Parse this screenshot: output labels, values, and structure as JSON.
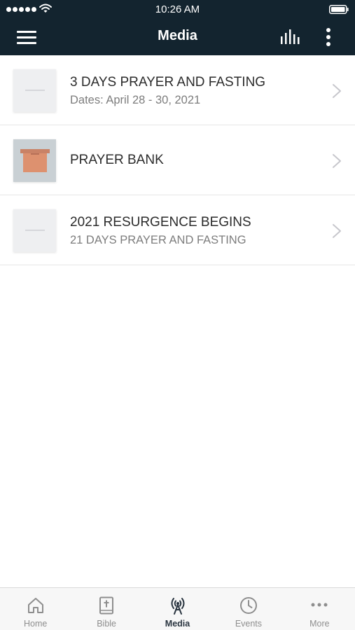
{
  "status_bar": {
    "time": "10:26 AM"
  },
  "header": {
    "title": "Media"
  },
  "media_list": [
    {
      "title": "3 DAYS PRAYER AND FASTING",
      "subtitle": "Dates: April 28 - 30, 2021",
      "thumbnail": "placeholder"
    },
    {
      "title": "PRAYER BANK",
      "subtitle": "",
      "thumbnail": "photo-copper-box"
    },
    {
      "title": "2021 RESURGENCE BEGINS",
      "subtitle": "21 DAYS PRAYER AND FASTING",
      "thumbnail": "placeholder"
    }
  ],
  "tab_bar": {
    "active": "Media",
    "tabs": [
      {
        "label": "Home",
        "icon": "home-icon"
      },
      {
        "label": "Bible",
        "icon": "bible-icon"
      },
      {
        "label": "Media",
        "icon": "broadcast-icon"
      },
      {
        "label": "Events",
        "icon": "clock-icon"
      },
      {
        "label": "More",
        "icon": "more-horizontal-icon"
      }
    ]
  },
  "colors": {
    "header_bg": "#13242f",
    "active_tab": "#2a3540",
    "inactive_tab": "#8e8e8e"
  }
}
